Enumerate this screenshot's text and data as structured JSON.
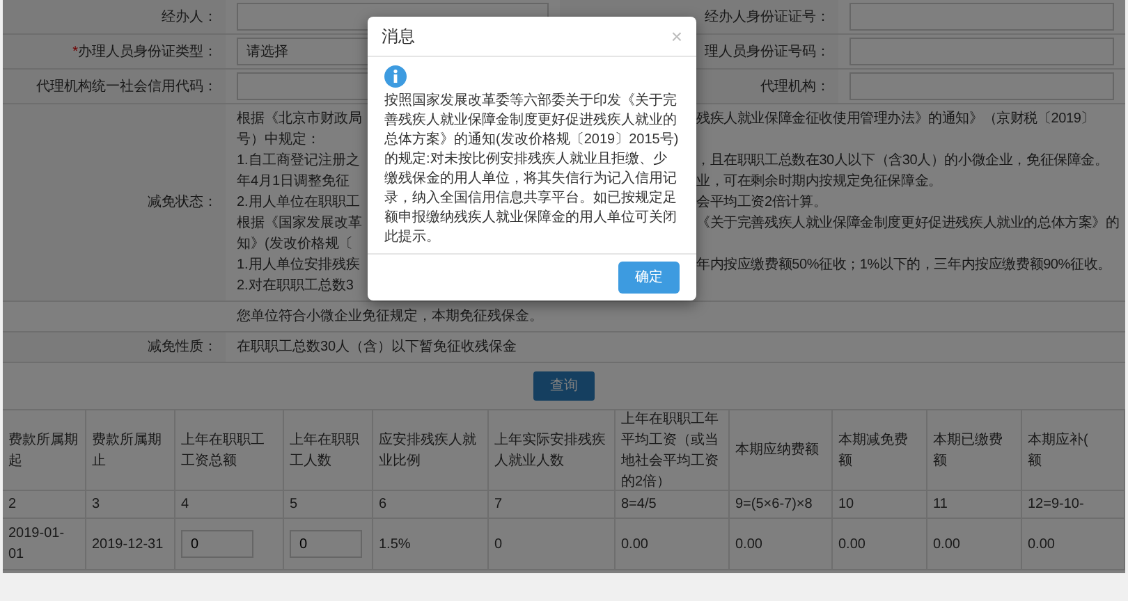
{
  "form_rows": [
    {
      "left": {
        "label": "经办人：",
        "field": {
          "kind": "input"
        }
      },
      "right": {
        "label": "经办人身份证证号：",
        "field": {
          "kind": "input"
        }
      }
    },
    {
      "left": {
        "required_mark": "*",
        "label": "办理人员身份证类型：",
        "field": {
          "kind": "select",
          "value": "请选择"
        }
      },
      "right": {
        "label": "理人员身份证号码：",
        "field": {
          "kind": "input"
        }
      }
    },
    {
      "left": {
        "label": "代理机构统一社会信用代码：",
        "field": {
          "kind": "input"
        }
      },
      "right": {
        "label": "代理机构：",
        "field": {
          "kind": "input"
        }
      }
    }
  ],
  "reduction_status": {
    "label": "减免状态：",
    "lines": [
      {
        "left": "根据《北京市财政局",
        "right": "残疾人就业保障金征收使用管理办法》的通知》（京财税〔2019〕"
      },
      {
        "left": "号）中规定："
      },
      {
        "left": "1.自工商登记注册之",
        "right": "，且在职职工总数在30人以下（含30人）的小微企业，免征保障金。"
      },
      {
        "left": "年4月1日调整免征",
        "right": "业，可在剩余时期内按规定免征保障金。"
      },
      {
        "left": "2.用人单位在职职工",
        "right": "会平均工资2倍计算。"
      },
      {
        "left": "根据《国家发展改革",
        "right": "《关于完善残疾人就业保障金制度更好促进残疾人就业的总体方案》的"
      },
      {
        "left": "知》(发改价格规〔"
      },
      {
        "left": "1.用人单位安排残疾",
        "right": "年内按应缴费额50%征收；1%以下的，三年内按应缴费额90%征收。"
      },
      {
        "left": "2.对在职职工总数3"
      }
    ],
    "result": "您单位符合小微企业免征规定，本期免征残保金。"
  },
  "reduction_type": {
    "label": "减免性质：",
    "value": "在职职工总数30人（含）以下暂免征收残保金"
  },
  "query_button": "查询",
  "table": {
    "columns": [
      "费款所属期起",
      "费款所属期止",
      "上年在职职工工资总额",
      "上年在职职工人数",
      "应安排残疾人就业比例",
      "上年实际安排残疾人就业人数",
      "上年在职职工年平均工资（或当地社会平均工资的2倍）",
      "本期应纳费额",
      "本期减免费额",
      "本期已缴费额",
      "本期应补(\n额"
    ],
    "rows": [
      [
        {
          "kind": "text",
          "text": "2"
        },
        {
          "kind": "text",
          "text": "3"
        },
        {
          "kind": "text",
          "text": "4"
        },
        {
          "kind": "text",
          "text": "5"
        },
        {
          "kind": "text",
          "text": "6"
        },
        {
          "kind": "text",
          "text": "7"
        },
        {
          "kind": "text",
          "text": "8=4/5"
        },
        {
          "kind": "text",
          "text": "9=(5×6-7)×8"
        },
        {
          "kind": "text",
          "text": "10"
        },
        {
          "kind": "text",
          "text": "11"
        },
        {
          "kind": "text",
          "text": "12=9-10-"
        }
      ],
      [
        {
          "kind": "text",
          "text": "2019-01-01"
        },
        {
          "kind": "text",
          "text": "2019-12-31"
        },
        {
          "kind": "input",
          "text": "0"
        },
        {
          "kind": "input",
          "text": "0"
        },
        {
          "kind": "text",
          "text": "1.5%"
        },
        {
          "kind": "text",
          "text": "0"
        },
        {
          "kind": "text",
          "text": "0.00"
        },
        {
          "kind": "text",
          "text": "0.00"
        },
        {
          "kind": "text",
          "text": "0.00"
        },
        {
          "kind": "text",
          "text": "0.00"
        },
        {
          "kind": "text",
          "text": "0.00"
        }
      ]
    ]
  },
  "dialog": {
    "title": "消息",
    "close": "×",
    "message": "按照国家发展改革委等六部委关于印发《关于完善残疾人就业保障金制度更好促进残疾人就业的总体方案》的通知(发改价格规〔2019〕2015号)的规定:对未按比例安排残疾人就业且拒缴、少缴残保金的用人单位，将其失信行为记入信用记录，纳入全国信用信息共享平台。如已按规定足额申报缴纳残疾人就业保障金的用人单位可关闭此提示。",
    "button": "确定"
  }
}
